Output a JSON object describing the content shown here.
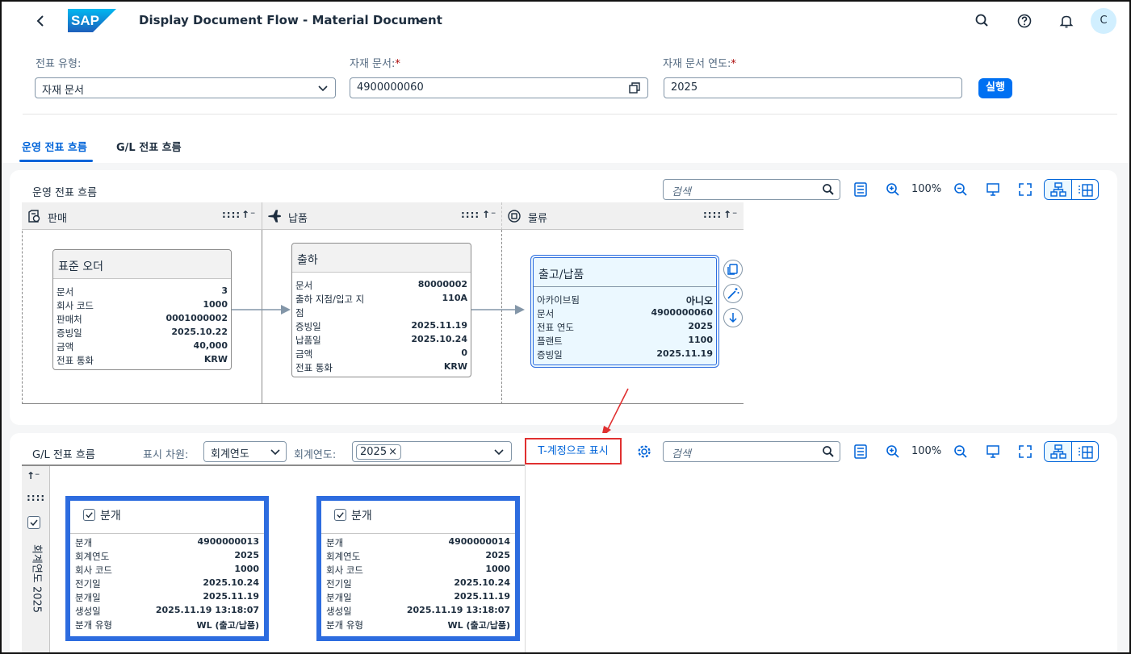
{
  "shell": {
    "app_title": "Display Document Flow - Material Document",
    "brand": "SAP",
    "avatar_initial": "C"
  },
  "header": {
    "doc_type_label": "전표 유형:",
    "doc_type_value": "자재 문서",
    "mat_doc_label": "자재 문서:",
    "mat_doc_value": "4900000060",
    "mat_doc_year_label": "자재 문서 연도:",
    "mat_doc_year_value": "2025",
    "required_mark": "*",
    "run_button": "실행"
  },
  "tabs": [
    {
      "label": "운영 전표 흐름",
      "selected": true
    },
    {
      "label": "G/L 전표 흐름",
      "selected": false
    }
  ],
  "ops_panel": {
    "title": "운영 전표 흐름",
    "search_placeholder": "검색",
    "zoom": "100%",
    "lanes": [
      {
        "name": "판매",
        "icon": "sales-icon",
        "ctl": "::::"
      },
      {
        "name": "납품",
        "icon": "delivery-plane-icon",
        "ctl": "::::"
      },
      {
        "name": "물류",
        "icon": "logistics-cubes-icon",
        "ctl": "::::"
      }
    ],
    "sort_label": "↑⁻",
    "nodes": [
      {
        "title": "표준 오더",
        "rows": [
          {
            "k": "문서",
            "v": "3"
          },
          {
            "k": "회사 코드",
            "v": "1000"
          },
          {
            "k": "판매처",
            "v": "0001000002"
          },
          {
            "k": "증빙일",
            "v": "2025.10.22"
          },
          {
            "k": "금액",
            "v": "40,000"
          },
          {
            "k": "전표 통화",
            "v": "KRW"
          }
        ]
      },
      {
        "title": "출하",
        "rows": [
          {
            "k": "문서",
            "v": "80000002"
          },
          {
            "k": "출하 지점/입고 지",
            "v": "110A"
          },
          {
            "k": "점",
            "v": ""
          },
          {
            "k": "증빙일",
            "v": "2025.11.19"
          },
          {
            "k": "납품일",
            "v": "2025.10.24"
          },
          {
            "k": "금액",
            "v": "0"
          },
          {
            "k": "전표 통화",
            "v": "KRW"
          }
        ]
      },
      {
        "title": "출고/납품",
        "rows": [
          {
            "k": "아카이브됨",
            "v": "아니오"
          },
          {
            "k": "문서",
            "v": "4900000060"
          },
          {
            "k": "전표 연도",
            "v": "2025"
          },
          {
            "k": "플랜트",
            "v": "1100"
          },
          {
            "k": "증빙일",
            "v": "2025.11.19"
          }
        ]
      }
    ]
  },
  "gl_panel": {
    "title": "G/L 전표 흐름",
    "dimension_label": "표시 차원:",
    "dimension_value": "회계연도",
    "fiscal_year_label": "회계연도:",
    "fiscal_year_token": "2025",
    "token_remove": "×",
    "t_account_button": "T-계정으로 표시",
    "search_placeholder": "검색",
    "zoom": "100%",
    "vertical_label": "회계연도 2025",
    "sort_label": "↑⁻",
    "ctl": "::::",
    "cards": [
      {
        "title": "분개",
        "rows": [
          {
            "k": "분개",
            "v": "4900000013"
          },
          {
            "k": "회계연도",
            "v": "2025"
          },
          {
            "k": "회사 코드",
            "v": "1000"
          },
          {
            "k": "전기일",
            "v": "2025.10.24"
          },
          {
            "k": "분개일",
            "v": "2025.11.19"
          },
          {
            "k": "생성일",
            "v": "2025.11.19 13:18:07"
          },
          {
            "k": "분개 유형",
            "v": "WL (출고/납품)"
          }
        ]
      },
      {
        "title": "분개",
        "rows": [
          {
            "k": "분개",
            "v": "4900000014"
          },
          {
            "k": "회계연도",
            "v": "2025"
          },
          {
            "k": "회사 코드",
            "v": "1000"
          },
          {
            "k": "전기일",
            "v": "2025.10.24"
          },
          {
            "k": "분개일",
            "v": "2025.11.19"
          },
          {
            "k": "생성일",
            "v": "2025.11.19 13:18:07"
          },
          {
            "k": "분개 유형",
            "v": "WL (출고/납품)"
          }
        ]
      }
    ]
  },
  "colors": {
    "accent": "#0064d9",
    "button": "#0070f2",
    "highlight_border": "#2d6cdf",
    "annotation_red": "#e03030"
  }
}
